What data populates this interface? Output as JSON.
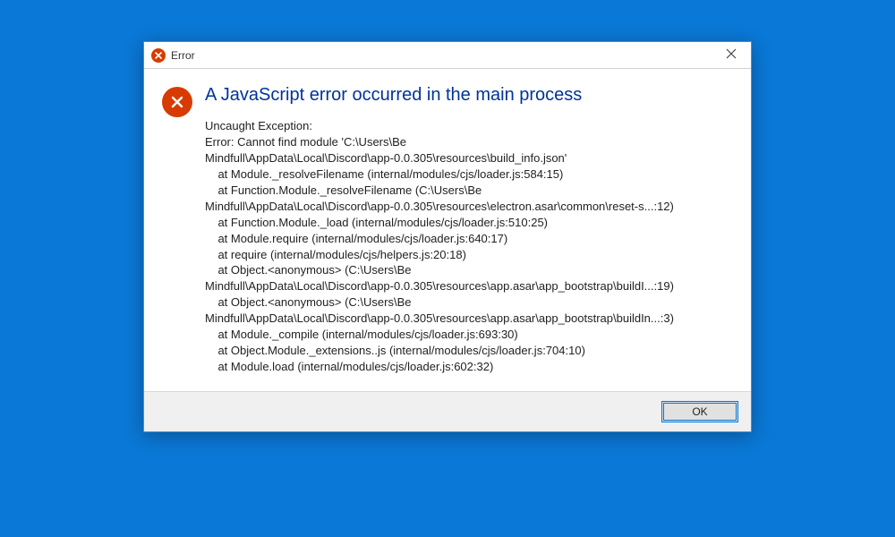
{
  "titlebar": {
    "title": "Error",
    "title_icon": "error-icon",
    "close_icon": "close-icon"
  },
  "content": {
    "icon": "error-icon",
    "heading": "A JavaScript error occurred in the main process",
    "message": "Uncaught Exception:\nError: Cannot find module 'C:\\Users\\Be\nMindfull\\AppData\\Local\\Discord\\app-0.0.305\\resources\\build_info.json'\n    at Module._resolveFilename (internal/modules/cjs/loader.js:584:15)\n    at Function.Module._resolveFilename (C:\\Users\\Be\nMindfull\\AppData\\Local\\Discord\\app-0.0.305\\resources\\electron.asar\\common\\reset-s...:12)\n    at Function.Module._load (internal/modules/cjs/loader.js:510:25)\n    at Module.require (internal/modules/cjs/loader.js:640:17)\n    at require (internal/modules/cjs/helpers.js:20:18)\n    at Object.<anonymous> (C:\\Users\\Be\nMindfull\\AppData\\Local\\Discord\\app-0.0.305\\resources\\app.asar\\app_bootstrap\\buildI...:19)\n    at Object.<anonymous> (C:\\Users\\Be\nMindfull\\AppData\\Local\\Discord\\app-0.0.305\\resources\\app.asar\\app_bootstrap\\buildIn...:3)\n    at Module._compile (internal/modules/cjs/loader.js:693:30)\n    at Object.Module._extensions..js (internal/modules/cjs/loader.js:704:10)\n    at Module.load (internal/modules/cjs/loader.js:602:32)"
  },
  "footer": {
    "ok_label": "OK"
  },
  "colors": {
    "background": "#0a78d6",
    "error_icon": "#d83b01",
    "heading": "#003399",
    "button_border": "#0078d7"
  }
}
